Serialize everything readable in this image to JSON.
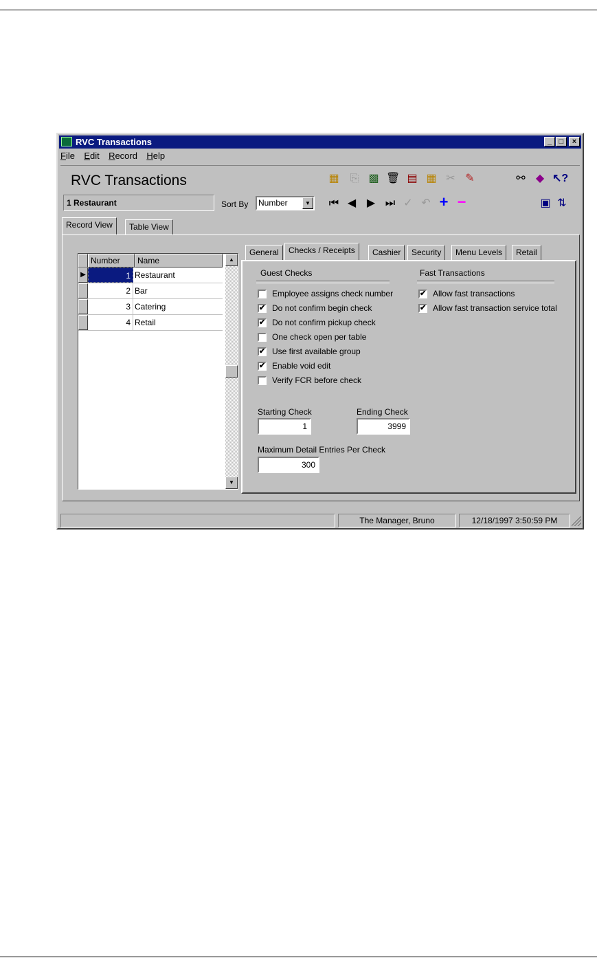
{
  "window": {
    "title": "RVC Transactions"
  },
  "menu": [
    "File",
    "Edit",
    "Record",
    "Help"
  ],
  "header": {
    "title": "RVC Transactions",
    "current_record": "1 Restaurant",
    "sort_label": "Sort By",
    "sort_value": "Number"
  },
  "toolbar_icons": [
    "new-record-icon",
    "copy-icon",
    "find-record-icon",
    "delete-icon",
    "clipboard-icon",
    "paste-icon",
    "cut-icon",
    "edit-icon",
    "binoculars-icon",
    "book-icon",
    "help-pointer-icon",
    "first-record-icon",
    "previous-record-icon",
    "next-record-icon",
    "last-record-icon",
    "confirm-icon",
    "undo-icon",
    "add-record-icon",
    "remove-record-icon",
    "view-icon",
    "refresh-icon"
  ],
  "main_tabs": [
    "Record View",
    "Table View"
  ],
  "grid": {
    "columns": [
      "Number",
      "Name"
    ],
    "rows": [
      {
        "number": "1",
        "name": "Restaurant"
      },
      {
        "number": "2",
        "name": "Bar"
      },
      {
        "number": "3",
        "name": "Catering"
      },
      {
        "number": "4",
        "name": "Retail"
      }
    ]
  },
  "sub_tabs": [
    "General",
    "Checks / Receipts",
    "Cashier",
    "Security",
    "Menu Levels",
    "Retail"
  ],
  "guest_checks": {
    "title": "Guest Checks",
    "options": [
      {
        "label": "Employee assigns check number",
        "checked": false
      },
      {
        "label": "Do not confirm begin check",
        "checked": true
      },
      {
        "label": "Do not confirm pickup check",
        "checked": true
      },
      {
        "label": "One check open per table",
        "checked": false
      },
      {
        "label": "Use first available group",
        "checked": true
      },
      {
        "label": "Enable void edit",
        "checked": true
      },
      {
        "label": "Verify FCR before check",
        "checked": false
      }
    ]
  },
  "fast_transactions": {
    "title": "Fast Transactions",
    "options": [
      {
        "label": "Allow fast transactions",
        "checked": true
      },
      {
        "label": "Allow fast transaction service total",
        "checked": true
      }
    ]
  },
  "fields": {
    "starting_check_label": "Starting Check",
    "starting_check": "1",
    "ending_check_label": "Ending Check",
    "ending_check": "3999",
    "max_detail_label": "Maximum Detail Entries Per Check",
    "max_detail": "300"
  },
  "status": {
    "user": "The Manager, Bruno",
    "datetime": "12/18/1997 3:50:59 PM"
  },
  "check_mark": "✔"
}
